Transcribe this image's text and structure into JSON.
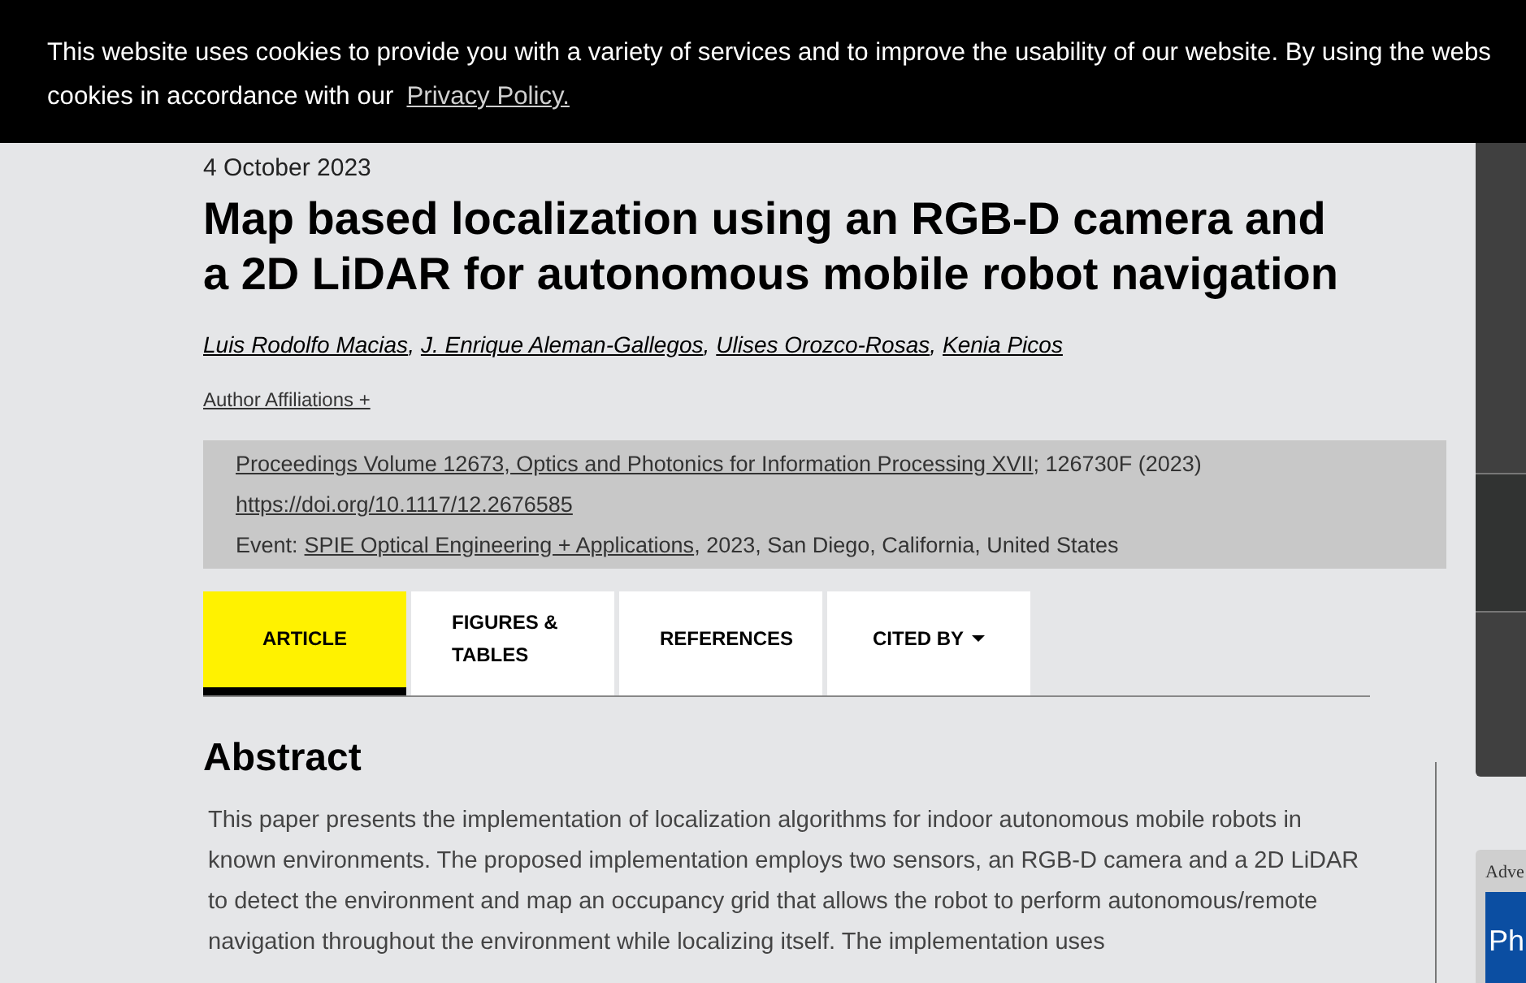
{
  "cookie_banner": {
    "text": "This website uses cookies to provide you with a variety of services and to improve the usability of our website. By using the webs",
    "text_line_2": "cookies in accordance with our",
    "link": "Privacy Policy."
  },
  "article": {
    "date": "4 October 2023",
    "title": "Map based localization using an RGB-D camera and a 2D LiDAR for autonomous mobile robot navigation",
    "authors": [
      {
        "name": "Luis Rodolfo Macias",
        "separator": ","
      },
      {
        "name": "J. Enrique Aleman-Gallegos",
        "separator": ","
      },
      {
        "name": "Ulises Orozco-Rosas",
        "separator": ","
      },
      {
        "name": "Kenia Picos"
      }
    ],
    "affiliations_link": "Author Affiliations +",
    "proceedings": {
      "link": "Proceedings Volume 12673, Optics and Photonics for Information Processing XVII",
      "suffix": "; 126730F (2023)",
      "doi": "https://doi.org/10.1117/12.2676585",
      "event_label": "Event:",
      "event_link": "SPIE Optical Engineering + Applications",
      "event_suffix": ", 2023, San Diego, California, United States"
    }
  },
  "tabs": [
    {
      "label": "ARTICLE",
      "selected": true,
      "dropdown": false
    },
    {
      "label": "FIGURES & TABLES",
      "selected": false,
      "dropdown": false
    },
    {
      "label": "REFERENCES",
      "selected": false,
      "dropdown": false
    },
    {
      "label": "CITED BY",
      "selected": false,
      "dropdown": true
    }
  ],
  "abstract": {
    "heading": "Abstract",
    "text": "This paper presents the implementation of localization algorithms for indoor autonomous mobile robots in known environments. The proposed implementation employs two sensors, an RGB-D camera and a 2D LiDAR to detect the environment and map an occupancy grid that allows the robot to perform autonomous/remote navigation throughout the environment while localizing itself. The implementation uses"
  },
  "sidebar": {
    "ad_label": "Adve",
    "ad_text": "Ph"
  }
}
